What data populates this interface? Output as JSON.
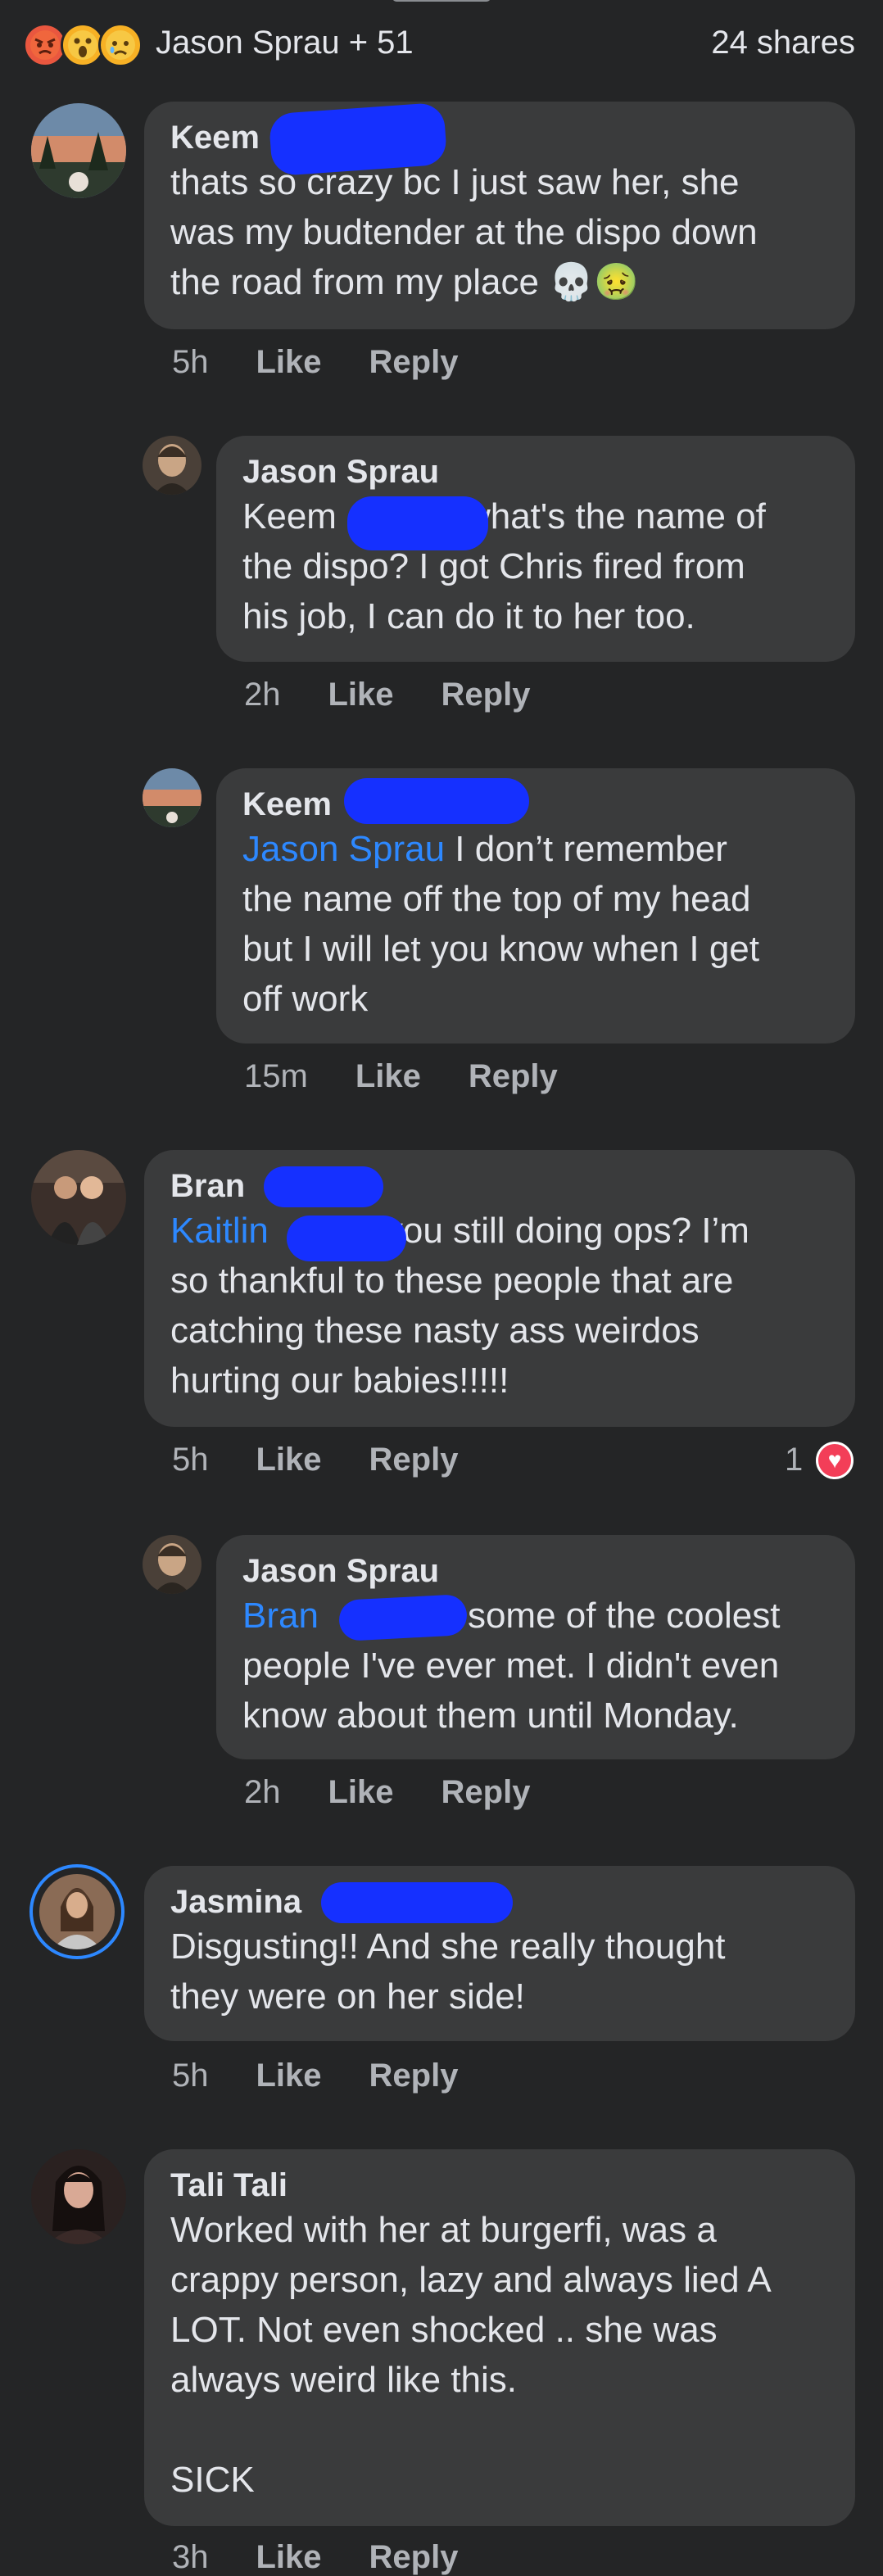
{
  "header": {
    "reactors": "Jason Sprau + 51",
    "shares": "24 shares",
    "reactions": [
      "angry",
      "wow",
      "sad"
    ]
  },
  "comments": [
    {
      "author": "Keem",
      "text": "thats so crazy bc I just saw her, she\nwas my budtender at the dispo down\nthe road from my place 💀🤢",
      "time": "5h",
      "like": "Like",
      "reply": "Reply"
    },
    {
      "author": "Jason Sprau",
      "text_a": "Keem",
      "text_b": "what's the name of\nthe dispo? I got Chris fired from\nhis job, I can do it to her too.",
      "time": "2h",
      "like": "Like",
      "reply": "Reply"
    },
    {
      "author": "Keem",
      "mention": "Jason Sprau",
      "text": " I don’t remember\nthe name off the top of my head\nbut I will let you know when I get\noff work",
      "time": "15m",
      "like": "Like",
      "reply": "Reply"
    },
    {
      "author": "Bran",
      "mention": "Kaitlin",
      "text_a": "you still doing ops? I’m",
      "text_b": "so thankful to these people that are\ncatching these nasty ass weirdos\nhurting our babies!!!!!",
      "time": "5h",
      "like": "Like",
      "reply": "Reply",
      "reaction_count": "1"
    },
    {
      "author": "Jason Sprau",
      "mention": "Bran",
      "text_a": "some of the coolest",
      "text_b": "people I've ever met. I didn't even\nknow about them until Monday.",
      "time": "2h",
      "like": "Like",
      "reply": "Reply"
    },
    {
      "author": "Jasmina",
      "text": "Disgusting!! And she really thought\nthey were on her side!",
      "time": "5h",
      "like": "Like",
      "reply": "Reply"
    },
    {
      "author": "Tali Tali",
      "text": "Worked with her at burgerfi, was a\ncrappy person, lazy and always lied A\nLOT. Not even shocked .. she was\nalways weird like this.\n\nSICK",
      "time": "3h",
      "like": "Like",
      "reply": "Reply"
    }
  ],
  "colors": {
    "background": "#242526",
    "bubble": "#3a3b3c",
    "mention": "#2d88ff",
    "redaction": "#1530ff",
    "heart": "#f33e58",
    "story_ring": "#2d88ff"
  }
}
